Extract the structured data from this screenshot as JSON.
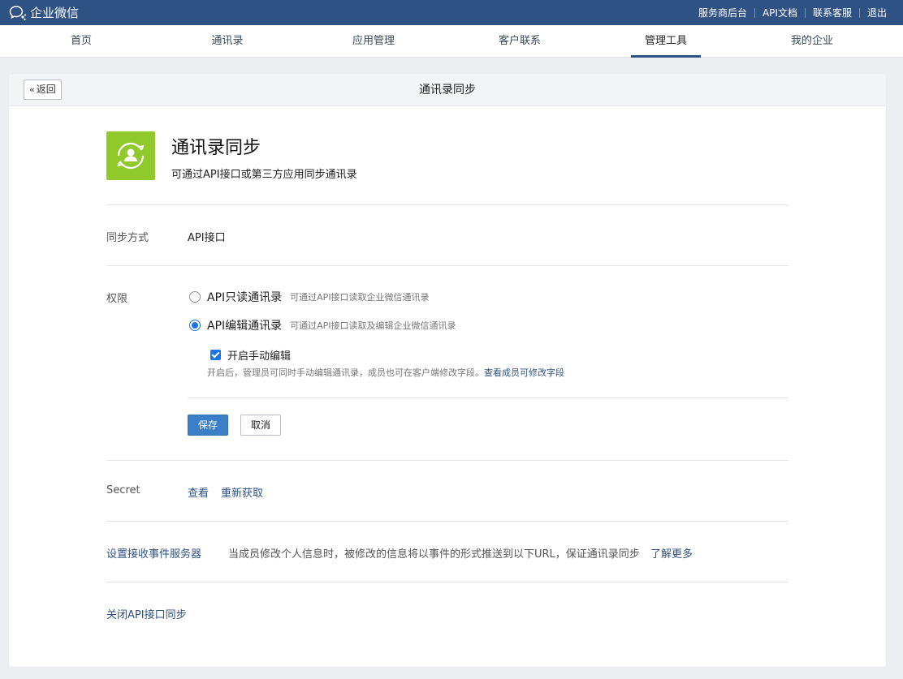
{
  "topbar": {
    "brand": "企业微信",
    "links": [
      "服务商后台",
      "API文档",
      "联系客服",
      "退出"
    ]
  },
  "nav": {
    "items": [
      "首页",
      "通讯录",
      "应用管理",
      "客户联系",
      "管理工具",
      "我的企业"
    ],
    "active": "管理工具"
  },
  "header": {
    "back_label": "返回",
    "title": "通讯录同步"
  },
  "app": {
    "icon": "contacts-sync-icon",
    "title": "通讯录同步",
    "description": "可通过API接口或第三方应用同步通讯录"
  },
  "sync_mode": {
    "label": "同步方式",
    "value": "API接口"
  },
  "permission": {
    "label": "权限",
    "options": [
      {
        "label": "API只读通讯录",
        "hint": "可通过API接口读取企业微信通讯录",
        "checked": false
      },
      {
        "label": "API编辑通讯录",
        "hint": "可通过API接口读取及编辑企业微信通讯录",
        "checked": true
      }
    ],
    "manual_edit": {
      "label": "开启手动编辑",
      "checked": true,
      "hint": "开启后，管理员可同时手动编辑通讯录，成员也可在客户端修改字段。",
      "hint_link": "查看成员可修改字段"
    },
    "save_label": "保存",
    "cancel_label": "取消"
  },
  "secret": {
    "label": "Secret",
    "view_label": "查看",
    "refresh_label": "重新获取"
  },
  "event_server": {
    "label": "设置接收事件服务器",
    "description": "当成员修改个人信息时，被修改的信息将以事件的形式推送到以下URL，保证通讯录同步",
    "link": "了解更多"
  },
  "close_sync_label": "关闭API接口同步",
  "colors": {
    "topbar": "#2e5283",
    "accent": "#1a73e8",
    "save_button": "#3a7fc8",
    "app_icon": "#8fc92b"
  }
}
